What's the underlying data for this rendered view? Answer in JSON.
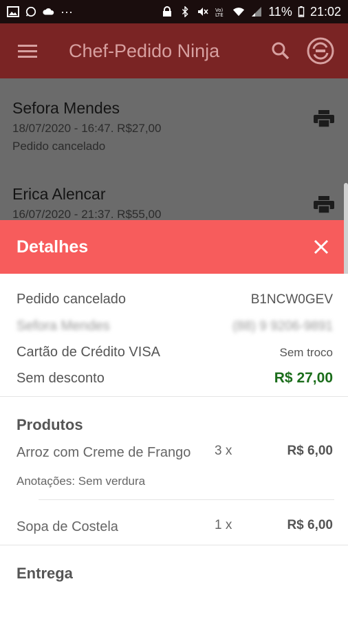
{
  "status_bar": {
    "battery": "11%",
    "time": "21:02",
    "dots": "···"
  },
  "app_bar": {
    "title": "Chef-Pedido Ninja"
  },
  "orders": [
    {
      "name": "Sefora Mendes",
      "meta": "18/07/2020 - 16:47. R$27,00",
      "status": "Pedido cancelado"
    },
    {
      "name": "Erica Alencar",
      "meta": "16/07/2020 - 21:37. R$55,00"
    }
  ],
  "details": {
    "header": "Detalhes",
    "status_label": "Pedido cancelado",
    "order_code": "B1NCW0GEV",
    "customer_name": "Sefora Mendes",
    "customer_phone": "(88) 9 9206-9891",
    "payment": "Cartão de Crédito VISA",
    "change": "Sem troco",
    "discount": "Sem desconto",
    "total": "R$ 27,00"
  },
  "products": {
    "title": "Produtos",
    "items": [
      {
        "name": "Arroz com Creme de Frango",
        "qty": "3 x",
        "price": "R$ 6,00",
        "note": "Anotações: Sem verdura"
      },
      {
        "name": "Sopa de Costela",
        "qty": "1 x",
        "price": "R$ 6,00"
      }
    ]
  },
  "delivery": {
    "title": "Entrega"
  },
  "colors": {
    "accent": "#f75c5c",
    "app_bar_dimmed": "#7a2424",
    "total_green": "#1b6d1b"
  }
}
